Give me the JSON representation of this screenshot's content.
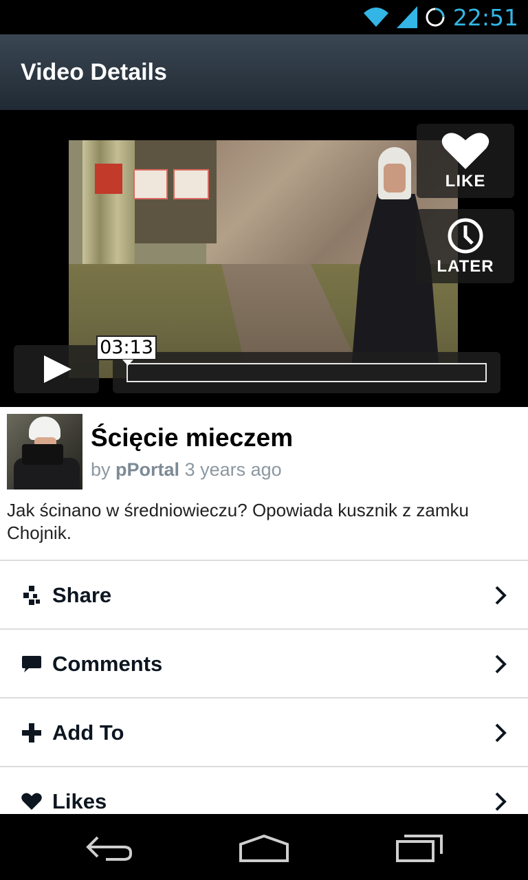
{
  "status_bar": {
    "time": "22:51",
    "icons": [
      "wifi-icon",
      "signal-icon",
      "sync-icon"
    ],
    "accent_color": "#33b5e5"
  },
  "action_bar": {
    "title": "Video Details"
  },
  "player": {
    "like_label": "LIKE",
    "later_label": "LATER",
    "time_label": "03:13",
    "progress": 0.0
  },
  "video": {
    "title": "Ścięcie mieczem",
    "by_prefix": "by",
    "author": "pPortal",
    "age": "3 years ago",
    "description": "Jak ścinano w średniowieczu? Opowiada kusznik z zamku Chojnik."
  },
  "menu": [
    {
      "label": "Share",
      "icon": "share-icon"
    },
    {
      "label": "Comments",
      "icon": "comment-icon"
    },
    {
      "label": "Add To",
      "icon": "plus-icon"
    },
    {
      "label": "Likes",
      "icon": "heart-icon"
    }
  ],
  "nav_bar": {
    "icons": [
      "back-icon",
      "home-icon",
      "recent-apps-icon"
    ]
  }
}
